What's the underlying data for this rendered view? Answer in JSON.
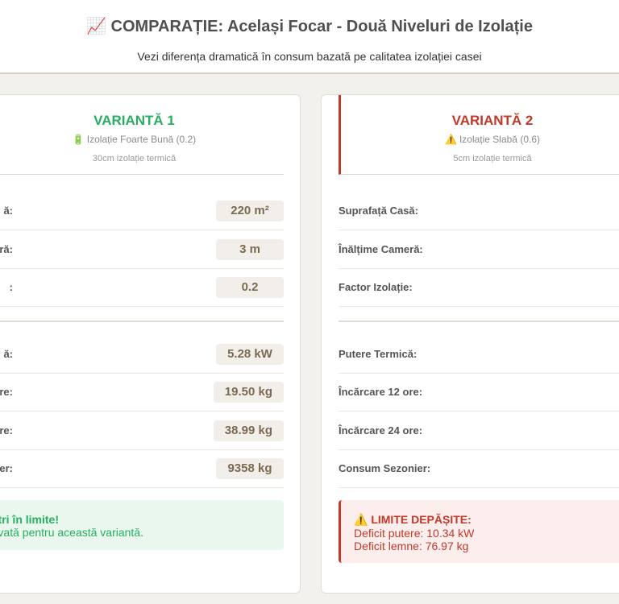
{
  "header": {
    "icon": "📈",
    "title": "COMPARAȚIE: Același Focar - Două Niveluri de Izolație",
    "subtitle": "Vezi diferența dramatică în consum bazată pe calitatea izolației casei"
  },
  "variant1": {
    "title": "VARIANTĂ 1",
    "subtitle_icon": "🔋",
    "subtitle": "Izolație Foarte Bună (0.2)",
    "note": "30cm izolație termică",
    "accent_color": "#27ae60",
    "inputs": [
      {
        "label": "ă:",
        "value": "220 m²"
      },
      {
        "label": "ră:",
        "value": "3 m"
      },
      {
        "label": ":",
        "value": "0.2"
      }
    ],
    "results": [
      {
        "label": "ă:",
        "value": "5.28 kW"
      },
      {
        "label": "re:",
        "value": "19.50 kg"
      },
      {
        "label": "re:",
        "value": "38.99 kg"
      },
      {
        "label": "nier:",
        "value": "9358 kg"
      }
    ],
    "status": {
      "title": "tri în limite!",
      "text": "adecvată pentru această variantă."
    }
  },
  "variant2": {
    "title": "VARIANTĂ 2",
    "subtitle_icon": "⚠️",
    "subtitle": "Izolație Slabă (0.6)",
    "note": "5cm izolație termică",
    "accent_color": "#c0392b",
    "inputs": [
      {
        "label": "Suprafață Casă:"
      },
      {
        "label": "Înălțime Cameră:"
      },
      {
        "label": "Factor Izolație:"
      }
    ],
    "results": [
      {
        "label": "Putere Termică:"
      },
      {
        "label": "Încărcare 12 ore:"
      },
      {
        "label": "Încărcare 24 ore:"
      },
      {
        "label": "Consum Sezonier:"
      }
    ],
    "status": {
      "title": "⚠️ LIMITE DEPĂȘITE:",
      "line1": "Deficit putere: 10.34 kW",
      "line2": "Deficit lemne: 76.97 kg"
    }
  }
}
